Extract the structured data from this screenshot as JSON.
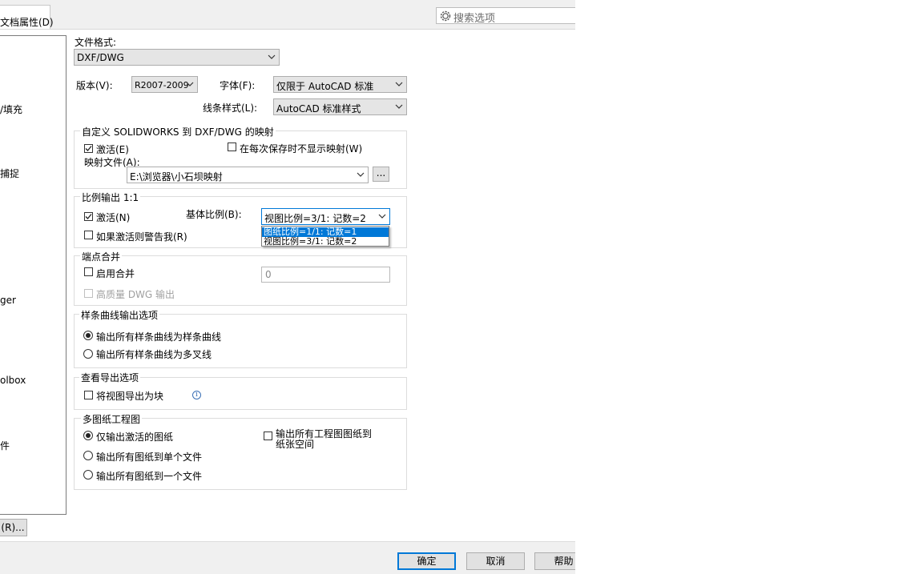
{
  "header": {
    "tab_label": "文档属性(D)",
    "search_placeholder": "搜索选项",
    "search_icon": "gear-icon"
  },
  "tree": {
    "items": [
      "/填充",
      "捕捉",
      "ger",
      "olbox",
      "件"
    ]
  },
  "left_button_label": "(R)...",
  "file_format": {
    "label": "文件格式:",
    "value": "DXF/DWG"
  },
  "version": {
    "label": "版本(V):",
    "value": "R2007-2009"
  },
  "font": {
    "label": "字体(F):",
    "value": "仅限于 AutoCAD 标准"
  },
  "line_style": {
    "label": "线条样式(L):",
    "value": "AutoCAD 标准样式"
  },
  "mapping": {
    "title": "自定义 SOLIDWORKS 到 DXF/DWG 的映射",
    "activate": {
      "label": "激活(E)",
      "checked": true
    },
    "no_show": {
      "label": "在每次保存时不显示映射(W)",
      "checked": false
    },
    "file_label": "映射文件(A):",
    "file_value": "E:\\浏览器\\小石坝映射",
    "browse_label": "..."
  },
  "scale": {
    "title": "比例输出 1:1",
    "activate": {
      "label": "激活(N)",
      "checked": true
    },
    "warn": {
      "label": "如果激活则警告我(R)",
      "checked": false
    },
    "base_label": "基体比例(B):",
    "base_value": "视图比例=3/1: 记数=2",
    "options": [
      "图纸比例=1/1: 记数=1",
      "视图比例=3/1: 记数=2"
    ],
    "highlighted_option": 0
  },
  "endpoint": {
    "title": "端点合并",
    "enable": {
      "label": "启用合并",
      "checked": false
    },
    "hq": {
      "label": "高质量 DWG 输出",
      "checked": false,
      "disabled": true
    },
    "tolerance_value": "0"
  },
  "spline": {
    "title": "样条曲线输出选项",
    "options": [
      "输出所有样条曲线为样条曲线",
      "输出所有样条曲线为多叉线"
    ],
    "selected": 0
  },
  "view_export": {
    "title": "查看导出选项",
    "as_block": {
      "label": "将视图导出为块",
      "checked": false
    },
    "info_icon": "info-icon"
  },
  "multi_sheet": {
    "title": "多图纸工程图",
    "options": [
      "仅输出激活的图纸",
      "输出所有图纸到单个文件",
      "输出所有图纸到一个文件"
    ],
    "selected": 0,
    "paper_space": {
      "label_line1": "输出所有工程图图纸到",
      "label_line2": "纸张空间",
      "checked": false
    }
  },
  "footer": {
    "ok": "确定",
    "cancel": "取消",
    "help": "帮助"
  }
}
